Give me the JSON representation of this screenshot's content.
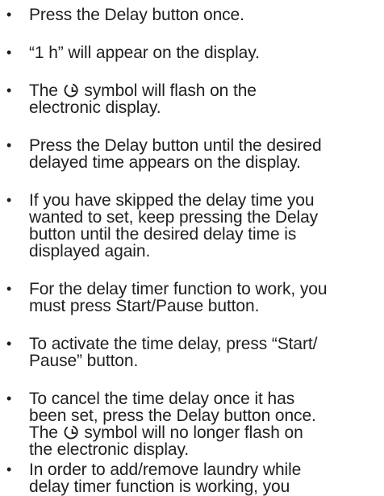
{
  "bullet_char": "•",
  "items": [
    {
      "lines": [
        "Press the Delay button once."
      ]
    },
    {
      "lines": [
        " “1 h” will appear on the display."
      ]
    },
    {
      "before": "The ",
      "after": " symbol will flash on the",
      "rest": [
        "electronic display."
      ],
      "icon": "delay-clock-icon"
    },
    {
      "lines": [
        "Press the Delay button until the desired",
        "delayed time appears on the display."
      ]
    },
    {
      "lines": [
        " If you have skipped the delay time you",
        "wanted to set, keep pressing the Delay",
        "button until the desired delay time is",
        "displayed again."
      ]
    },
    {
      "lines": [
        "For the delay timer function to work, you",
        "must press Start/Pause button."
      ]
    },
    {
      "lines": [
        "To activate the time delay, press “Start/",
        "Pause” button."
      ]
    },
    {
      "lines": [
        "To cancel the time delay once it has",
        "been set, press the Delay button once."
      ],
      "before": "The ",
      "after": " symbol will no longer flash on",
      "rest": [
        "the electronic display."
      ],
      "icon": "delay-clock-icon"
    },
    {
      "lines": [
        "In order to add/remove laundry while",
        "delay timer function is working, you"
      ]
    }
  ]
}
